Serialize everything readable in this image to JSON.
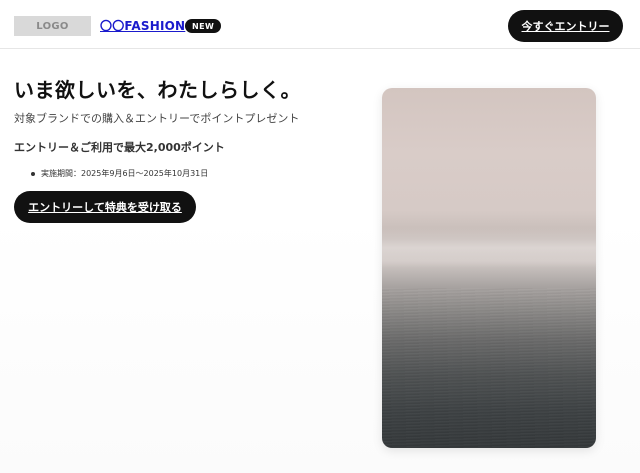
{
  "header": {
    "logo_text": "LOGO",
    "brand_name": "〇〇FASHION",
    "badge": "NEW",
    "cta_label": "今すぐエントリー"
  },
  "hero": {
    "title": "いま欲しいを、わたしらしく。",
    "subtitle": "対象ブランドでの購入＆エントリーでポイントプレゼント",
    "points_text": "エントリー＆ご利用で最大2,000ポイント",
    "period_items": [
      "実施期間：2025年9月6日〜2025年10月31日"
    ],
    "cta_label": "エントリーして特典を受け取る"
  },
  "colors": {
    "button_bg": "#111111",
    "button_text": "#ffffff",
    "link": "#1a1acc",
    "logo_placeholder": "#d9d9d9"
  }
}
